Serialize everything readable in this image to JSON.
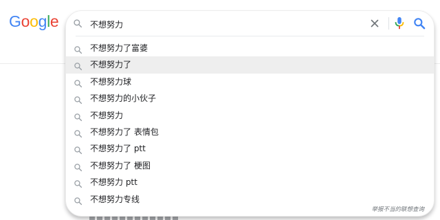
{
  "logo": {
    "letters": [
      "G",
      "o",
      "o",
      "g",
      "l",
      "e"
    ],
    "colors": [
      "#4285f4",
      "#ea4335",
      "#fbbc05",
      "#4285f4",
      "#34a853",
      "#ea4335"
    ]
  },
  "search": {
    "query": "不想努力",
    "clear_icon": "close-icon",
    "mic_icon": "microphone-icon",
    "search_icon": "search-icon"
  },
  "suggestions": [
    {
      "text": "不想努力了富婆",
      "highlighted": false
    },
    {
      "text": "不想努力了",
      "highlighted": true
    },
    {
      "text": "不想努力球",
      "highlighted": false
    },
    {
      "text": "不想努力的小伙子",
      "highlighted": false
    },
    {
      "text": "不想努力",
      "highlighted": false
    },
    {
      "text": "不想努力了 表情包",
      "highlighted": false
    },
    {
      "text": "不想努力了 ptt",
      "highlighted": false
    },
    {
      "text": "不想努力了 梗图",
      "highlighted": false
    },
    {
      "text": "不想努力 ptt",
      "highlighted": false
    },
    {
      "text": "不想努力专线",
      "highlighted": false
    }
  ],
  "footer": {
    "report_link": "举报不当的联想查询"
  },
  "colors": {
    "accent_blue": "#4285f4",
    "mic_red": "#ea4335",
    "mic_yellow": "#fbbc05",
    "mic_green": "#34a853",
    "icon_gray": "#9aa0a6",
    "highlight_bg": "#eeeeee"
  }
}
